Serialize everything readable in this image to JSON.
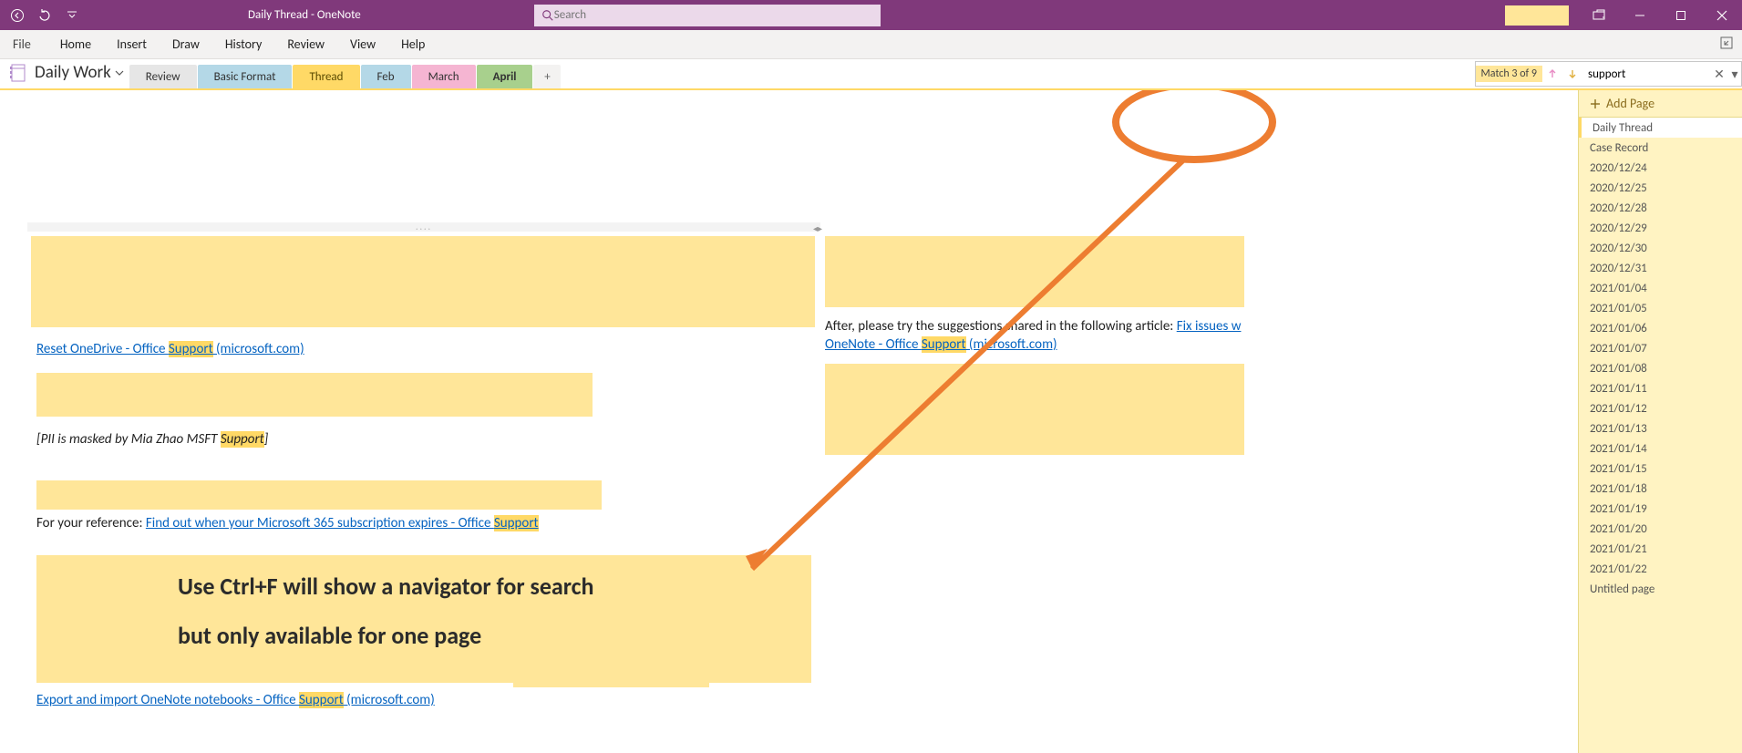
{
  "titlebar": {
    "title": "Daily Thread  -  OneNote",
    "search_placeholder": "Search"
  },
  "menu": [
    "File",
    "Home",
    "Insert",
    "Draw",
    "History",
    "Review",
    "View",
    "Help"
  ],
  "notebook": {
    "name": "Daily Work"
  },
  "tabs": [
    {
      "label": "Review",
      "cls": "grey"
    },
    {
      "label": "Basic Format",
      "cls": "blue"
    },
    {
      "label": "Thread",
      "cls": "yellow"
    },
    {
      "label": "Feb",
      "cls": "lightblue"
    },
    {
      "label": "March",
      "cls": "pink"
    },
    {
      "label": "April",
      "cls": "green"
    }
  ],
  "find": {
    "match_label": "Match 3 of 9",
    "value": "support"
  },
  "content": {
    "link1_pre": "Reset OneDrive - Office ",
    "link1_hl": "Support",
    "link1_post": " (microsoft.com)",
    "pii_pre": "[PII is masked by Mia Zhao MSFT ",
    "pii_hl": "Support",
    "pii_post": "]",
    "ref_pre": "For your reference: ",
    "ref_link_pre": "Find out when your Microsoft 365 subscription expires - Office ",
    "ref_link_hl": "Support",
    "link3_pre": "Export and import OneNote notebooks - Office ",
    "link3_hl": "Support",
    "link3_post": " (microsoft.com)",
    "right_para_pre": "After, please try the suggestions shared in the following article: ",
    "right_link_pre": "Fix issues w",
    "right_line2_pre": "OneNote - Office ",
    "right_line2_hl": "Support",
    "right_line2_post": " (microsoft.com)"
  },
  "tip": {
    "line1": "Use Ctrl+F will show a navigator for search",
    "line2": "but only available for one page"
  },
  "pages_header": "Add Page",
  "pages": [
    "Daily Thread",
    "Case Record",
    "2020/12/24",
    "2020/12/25",
    "2020/12/28",
    "2020/12/29",
    "2020/12/30",
    "2020/12/31",
    "2021/01/04",
    "2021/01/05",
    "2021/01/06",
    "2021/01/07",
    "2021/01/08",
    "2021/01/11",
    "2021/01/12",
    "2021/01/13",
    "2021/01/14",
    "2021/01/15",
    "2021/01/18",
    "2021/01/19",
    "2021/01/20",
    "2021/01/21",
    "2021/01/22",
    "Untitled page"
  ]
}
